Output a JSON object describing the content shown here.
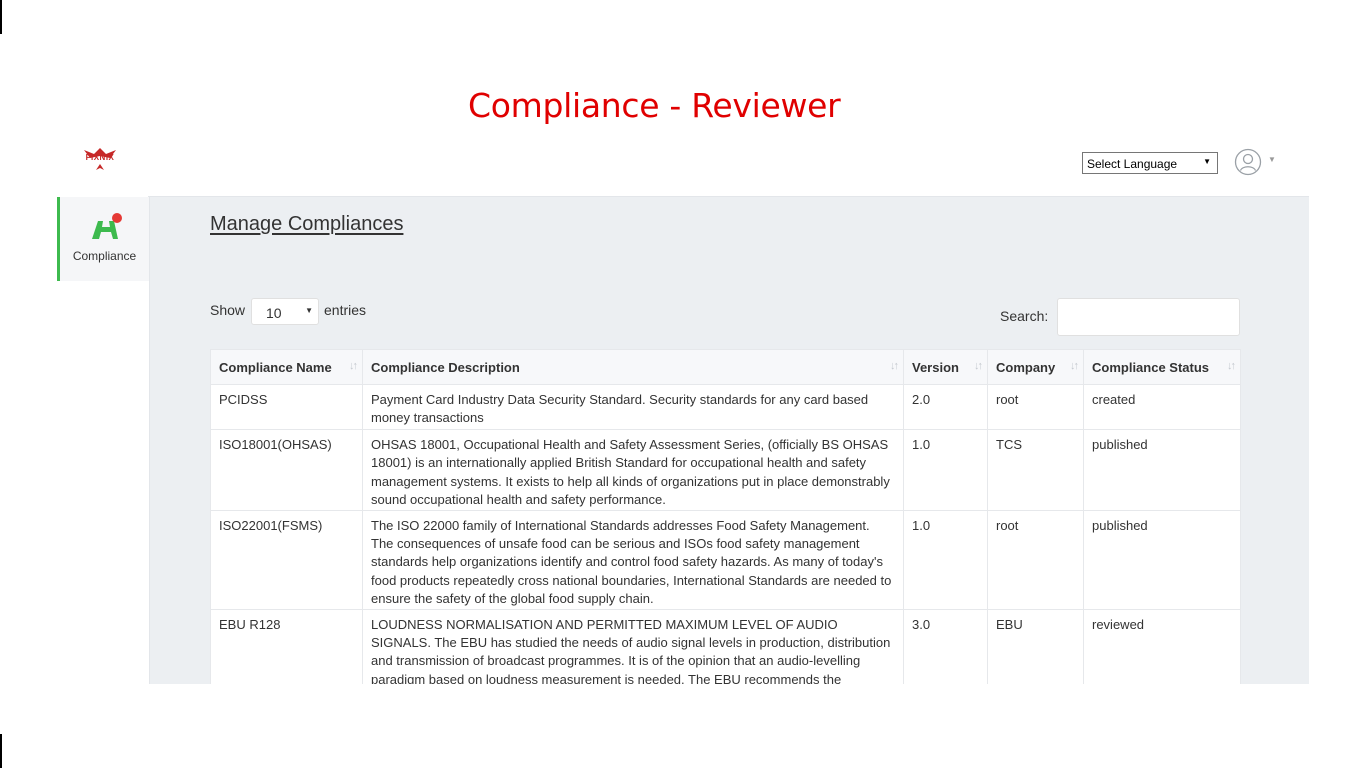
{
  "slide_title": "Compliance - Reviewer",
  "brand": {
    "logo_text": "FIXNIX"
  },
  "header": {
    "language_select": "Select Language"
  },
  "sidebar": {
    "items": [
      {
        "label": "Compliance",
        "active": true
      }
    ]
  },
  "main": {
    "title": "Manage Compliances",
    "show_label": "Show",
    "page_size": "10",
    "entries_label": "entries",
    "search_label": "Search:",
    "search_value": ""
  },
  "table": {
    "columns": [
      "Compliance Name",
      "Compliance Description",
      "Version",
      "Company",
      "Compliance Status"
    ],
    "rows": [
      {
        "name": "PCIDSS",
        "description": "Payment Card Industry Data Security Standard. Security standards for any card based money transactions",
        "version": "2.0",
        "company": "root",
        "status": "created"
      },
      {
        "name": "ISO18001(OHSAS)",
        "description": "OHSAS 18001, Occupational Health and Safety Assessment Series, (officially BS OHSAS 18001) is an internationally applied British Standard for occupational health and safety management systems. It exists to help all kinds of organizations put in place demonstrably sound occupational health and safety performance.",
        "version": "1.0",
        "company": "TCS",
        "status": "published"
      },
      {
        "name": "ISO22001(FSMS)",
        "description": "The ISO 22000 family of International Standards addresses Food Safety Management. The consequences of unsafe food can be serious and ISOs food safety management standards help organizations identify and control food safety hazards. As many of today's food products repeatedly cross national boundaries, International Standards are needed to ensure the safety of the global food supply chain.",
        "version": "1.0",
        "company": "root",
        "status": "published"
      },
      {
        "name": "EBU R128",
        "description": "LOUDNESS NORMALISATION AND PERMITTED MAXIMUM LEVEL OF AUDIO SIGNALS. The EBU has studied the needs of audio signal levels in production, distribution and transmission of broadcast programmes. It is of the opinion that an audio-levelling paradigm based on loudness measurement is needed. The EBU recommends the measurement of the average loudness of a programme (Programme",
        "version": "3.0",
        "company": "EBU",
        "status": "reviewed"
      }
    ]
  }
}
